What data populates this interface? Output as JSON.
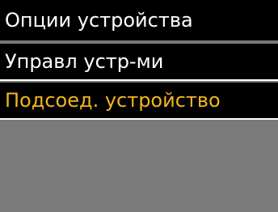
{
  "header": {
    "title": "Опции устройства"
  },
  "menu": {
    "items": [
      {
        "label": "Управл устр-ми",
        "selected": false
      },
      {
        "label": "Подсоед. устройство",
        "selected": true
      }
    ]
  },
  "colors": {
    "background": "#000000",
    "text": "#ffffff",
    "selected_text": "#f2b51d",
    "empty_area": "#7a7a7a",
    "separator": "#ffffff"
  }
}
